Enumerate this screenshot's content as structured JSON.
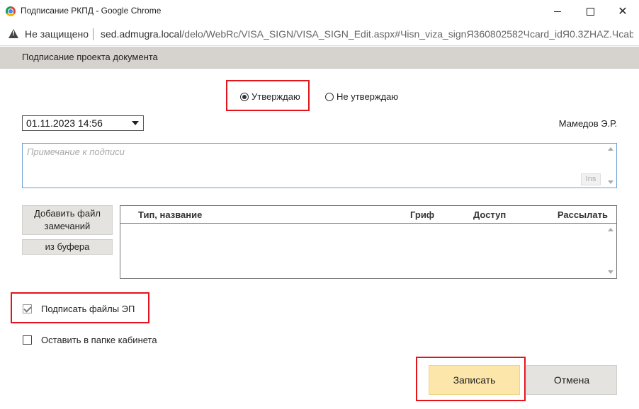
{
  "window": {
    "title": "Подписание РКПД - Google Chrome"
  },
  "addressbar": {
    "security_label": "Не защищено",
    "url_host": "sed.admugra.local",
    "url_path": "/delo/WebRc/VISA_SIGN/VISA_SIGN_Edit.aspx#Чisn_viza_signЯ360802582Чcard_idЯ0.3ZHAZ.Чcabin..."
  },
  "header": {
    "title": "Подписание проекта документа"
  },
  "decision": {
    "options": [
      {
        "label": "Утверждаю",
        "checked": true
      },
      {
        "label": "Не утверждаю",
        "checked": false
      }
    ]
  },
  "sign_date": {
    "value": "01.11.2023 14:56"
  },
  "signer": {
    "name": "Мамедов Э.Р."
  },
  "note": {
    "placeholder": "Примечание к подписи",
    "ins_label": "Ins"
  },
  "files": {
    "add_button_label": "Добавить файл замечаний",
    "buffer_button_label": "из буфера",
    "columns": [
      "Тип, название",
      "Гриф",
      "Доступ",
      "Рассылать"
    ],
    "rows": []
  },
  "options": {
    "sign_files_label": "Подписать файлы ЭП",
    "sign_files_checked": true,
    "keep_in_folder_label": "Оставить в папке кабинета",
    "keep_in_folder_checked": false
  },
  "actions": {
    "save_label": "Записать",
    "cancel_label": "Отмена"
  },
  "colors": {
    "highlight": "#e3141c",
    "save_button": "#fde6aa",
    "header_band": "#d6d3cf"
  }
}
